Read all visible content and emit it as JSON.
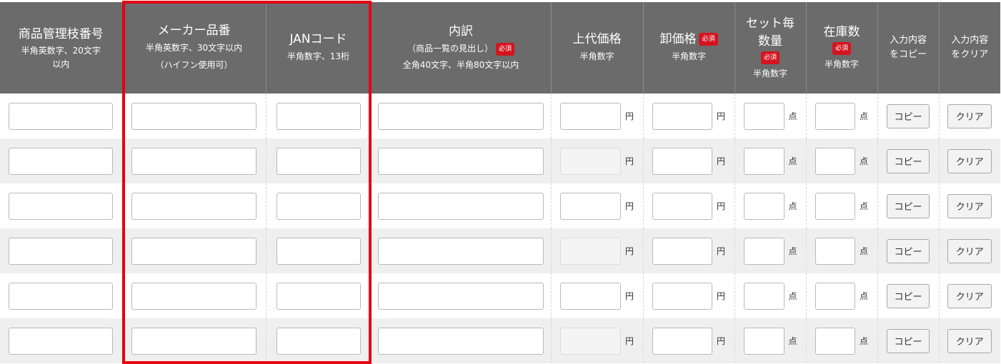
{
  "columns": [
    {
      "title": "商品管理枝番号",
      "sub1": "半角英数字、20文字",
      "sub2": "以内"
    },
    {
      "title": "メーカー品番",
      "sub1": "半角英数字、30文字以内",
      "sub2": "（ハイフン使用可）"
    },
    {
      "title": "JANコード",
      "sub1": "半角数字、13桁"
    },
    {
      "title": "内訳",
      "sub1": "（商品一覧の見出し）",
      "sub2": "全角40文字、半角80文字以内"
    },
    {
      "title": "上代価格",
      "sub1": "半角数字"
    },
    {
      "title": "卸価格",
      "sub1": "半角数字"
    },
    {
      "title1": "セット毎",
      "title2": "数量",
      "sub1": "半角数字"
    },
    {
      "title": "在庫数",
      "sub1": "半角数字"
    },
    {
      "line1": "入力内容",
      "line2": "をコピー"
    },
    {
      "line1": "入力内容",
      "line2": "をクリア"
    }
  ],
  "required_badge": "必須",
  "units": {
    "yen": "円",
    "count": "点"
  },
  "buttons": {
    "copy": "コピー",
    "clear": "クリア"
  },
  "rows": [
    {
      "retail_price_enabled": true
    },
    {
      "retail_price_enabled": false
    },
    {
      "retail_price_enabled": true
    },
    {
      "retail_price_enabled": false
    },
    {
      "retail_price_enabled": true
    },
    {
      "retail_price_enabled": false
    }
  ],
  "colors": {
    "header_bg": "#6b6b6b",
    "required_badge": "#d4141f",
    "highlight_frame": "#e60012",
    "row_alt_bg": "#efefef"
  }
}
